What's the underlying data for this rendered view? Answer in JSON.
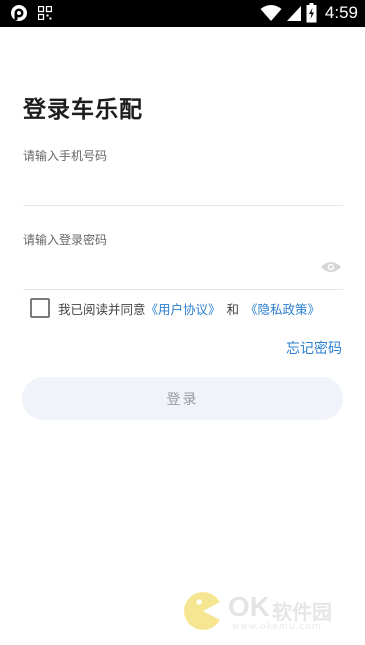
{
  "status_bar": {
    "time": "4:59",
    "icons": [
      "notification-app-icon",
      "qr-code-icon",
      "wifi-icon",
      "signal-icon",
      "battery-icon"
    ]
  },
  "login": {
    "title": "登录车乐配",
    "phone": {
      "label": "请输入手机号码",
      "value": ""
    },
    "password": {
      "label": "请输入登录密码",
      "value": ""
    },
    "agreement": {
      "prefix": "我已阅读并同意",
      "user_agreement": "《用户协议》",
      "and": "和",
      "privacy_policy": "《隐私政策》",
      "checked": false
    },
    "forgot_password": "忘记密码",
    "login_button": "登录"
  },
  "watermark": {
    "text_brand": "OK",
    "text_cn": "软件园",
    "url": "www.okemu.com"
  },
  "colors": {
    "link": "#2b7fd0",
    "button_bg": "#f1f3fa",
    "button_text": "#9a9aa2",
    "title": "#1d1d1d"
  }
}
